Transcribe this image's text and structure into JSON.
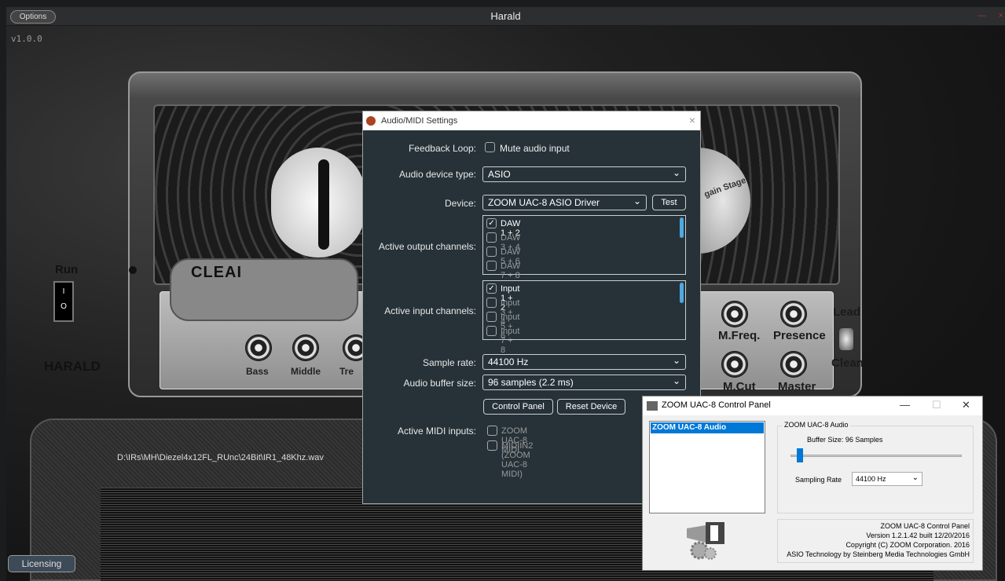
{
  "app": {
    "title": "Harald",
    "options_label": "Options",
    "version": "v1.0.0",
    "licensing_label": "Licensing",
    "ir_path": "D:\\IRs\\MH\\Diezel4x12FL_RUnc\\24Bit\\IR1_48Khz.wav"
  },
  "amp": {
    "run_label": "Run",
    "switch_on": "I",
    "switch_off": "O",
    "brand": "CLEAI",
    "name": "HARALD",
    "stage_logo": "gain Stage",
    "knobs": {
      "bass": "Bass",
      "middle": "Middle",
      "treble": "Tre",
      "mfreq": "M.Freq.",
      "presence": "Presence",
      "mcut": "M.Cut",
      "master": "Master"
    },
    "lead_label": "Lead",
    "clean_label": "Clean"
  },
  "audio_dialog": {
    "title": "Audio/MIDI Settings",
    "feedback_label": "Feedback Loop:",
    "mute_label": "Mute audio input",
    "device_type_label": "Audio device type:",
    "device_type_value": "ASIO",
    "device_label": "Device:",
    "device_value": "ZOOM UAC-8 ASIO Driver",
    "test_label": "Test",
    "output_label": "Active output channels:",
    "outputs": [
      {
        "label": "DAW 1 + 2",
        "checked": "✓"
      },
      {
        "label": "DAW 3 + 4",
        "checked": ""
      },
      {
        "label": "DAW 5 + 6",
        "checked": ""
      },
      {
        "label": "DAW 7 + 8",
        "checked": ""
      }
    ],
    "input_label": "Active input channels:",
    "inputs": [
      {
        "label": "Input 1 + 2",
        "checked": "✓"
      },
      {
        "label": "Input 3 + 4",
        "checked": ""
      },
      {
        "label": "Input 5 + 6",
        "checked": ""
      },
      {
        "label": "Input 7 + 8",
        "checked": ""
      }
    ],
    "sample_rate_label": "Sample rate:",
    "sample_rate_value": "44100 Hz",
    "buffer_label": "Audio buffer size:",
    "buffer_value": "96 samples (2.2 ms)",
    "control_panel_label": "Control Panel",
    "reset_label": "Reset Device",
    "midi_label": "Active MIDI inputs:",
    "midi_inputs": [
      "ZOOM UAC-8 MIDI",
      "MIDIIN2 (ZOOM UAC-8 MIDI)"
    ]
  },
  "zoom_panel": {
    "title": "ZOOM UAC-8 Control Panel",
    "list_item": "ZOOM UAC-8 Audio",
    "group_label": "ZOOM UAC-8 Audio",
    "buffer_text": "Buffer Size:  96 Samples",
    "buffer_fraction": 0.04,
    "sampling_label": "Sampling Rate",
    "sampling_value": "44100 Hz",
    "info": [
      "ZOOM UAC-8 Control Panel",
      "Version 1.2.1.42  built 12/20/2016",
      "Copyright (C) ZOOM Corporation. 2016",
      "ASIO Technology by Steinberg Media Technologies GmbH"
    ]
  }
}
